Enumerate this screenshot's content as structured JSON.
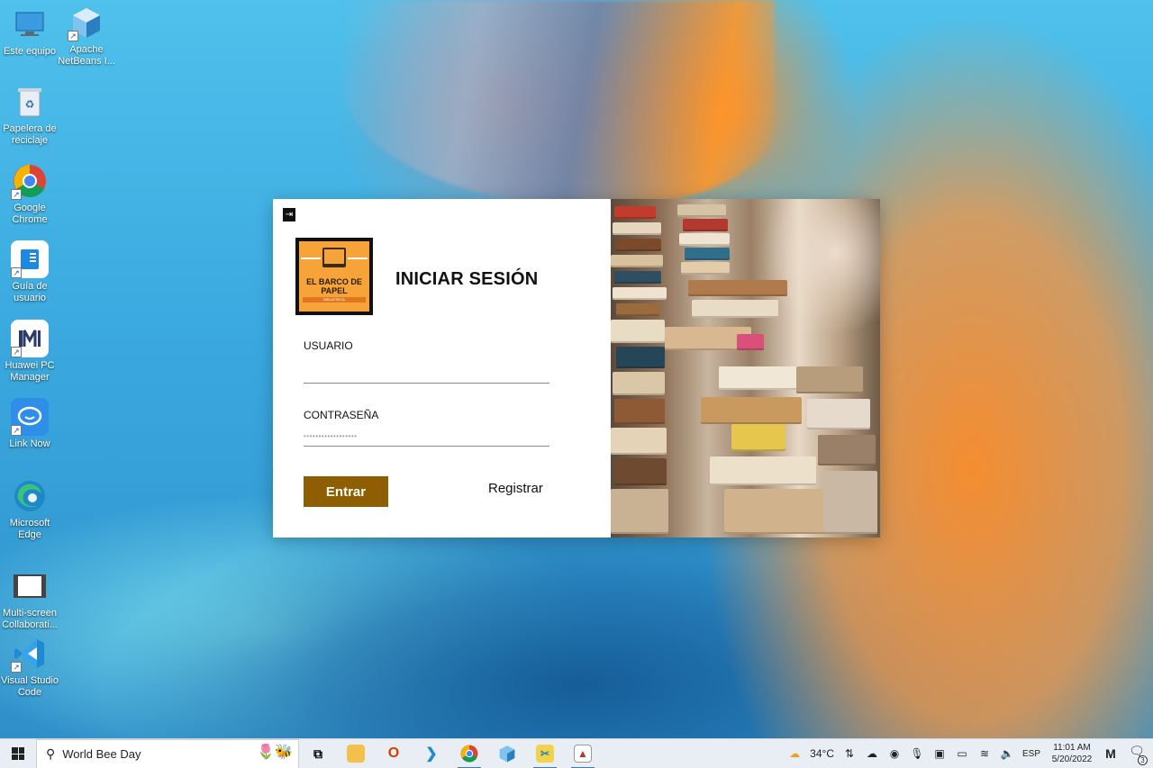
{
  "desktop": {
    "icons": [
      {
        "label": "Este equipo",
        "icon": "computer-icon"
      },
      {
        "label": "Apache NetBeans I...",
        "icon": "netbeans-icon"
      },
      {
        "label": "Papelera de reciclaje",
        "icon": "recycle-bin-icon"
      },
      {
        "label": "Google Chrome",
        "icon": "chrome-icon"
      },
      {
        "label": "Guía de usuario",
        "icon": "user-guide-icon"
      },
      {
        "label": "Huawei PC Manager",
        "icon": "huawei-pc-manager-icon"
      },
      {
        "label": "Link Now",
        "icon": "link-now-icon"
      },
      {
        "label": "Microsoft Edge",
        "icon": "edge-icon"
      },
      {
        "label": "Multi-screen Collaborati...",
        "icon": "multi-screen-icon"
      },
      {
        "label": "Visual Studio Code",
        "icon": "vscode-icon"
      }
    ]
  },
  "login": {
    "logo": {
      "line1": "EL BARCO DE",
      "line2": "PAPEL",
      "subtitle": "BIBLIOTECA"
    },
    "title": "INICIAR SESIÓN",
    "username_label": "USUARIO",
    "username_value": "",
    "password_label": "CONTRASEÑA",
    "password_value": "••••••••••••••••••",
    "enter_button": "Entrar",
    "register_link": "Registrar",
    "accent_color": "#8e5e00"
  },
  "taskbar": {
    "search_text": "World Bee Day",
    "apps": [
      "task-view-icon",
      "file-explorer-icon",
      "office-icon",
      "vscode-icon",
      "chrome-icon",
      "netbeans-icon",
      "snipping-tool-icon",
      "java-app-icon"
    ],
    "weather": "34°C",
    "language": "ESP",
    "time": "11:01 AM",
    "date": "5/20/2022",
    "notification_count": "3"
  }
}
